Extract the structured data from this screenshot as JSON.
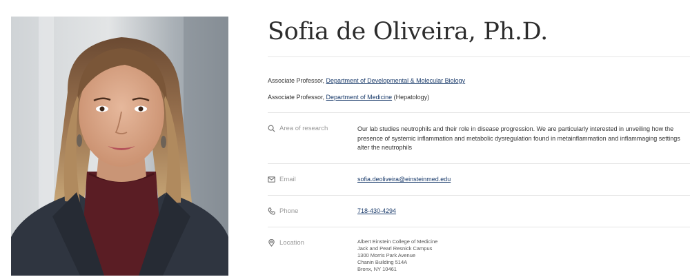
{
  "profile": {
    "name": "Sofia de Oliveira, Ph.D."
  },
  "appointments": [
    {
      "title": "Associate Professor, ",
      "department": "Department of Developmental & Molecular Biology",
      "suffix": ""
    },
    {
      "title": "Associate Professor, ",
      "department": "Department of Medicine",
      "suffix": " (Hepatology)"
    }
  ],
  "research": {
    "label": "Area of research",
    "icon": "search-icon",
    "text": "Our lab studies neutrophils and their role in disease progression. We are particularly interested in unveiling how the presence of systemic inflammation and metabolic dysregulation found in metainflammation and inflammaging settings alter the neutrophils"
  },
  "email": {
    "label": "Email",
    "icon": "envelope-icon",
    "value": "sofia.deoliveira@einsteinmed.edu"
  },
  "phone": {
    "label": "Phone",
    "icon": "phone-icon",
    "value": "718-430-4294"
  },
  "location": {
    "label": "Location",
    "icon": "location-pin-icon",
    "lines": [
      "Albert Einstein College of Medicine",
      "Jack and Pearl Resnick Campus",
      "1300 Morris Park Avenue",
      "Chanin Building 514A",
      "Bronx, NY 10461"
    ]
  },
  "colors": {
    "link": "#1a3b6b",
    "label": "#9a9a9a",
    "divider": "#e4e4e4"
  }
}
